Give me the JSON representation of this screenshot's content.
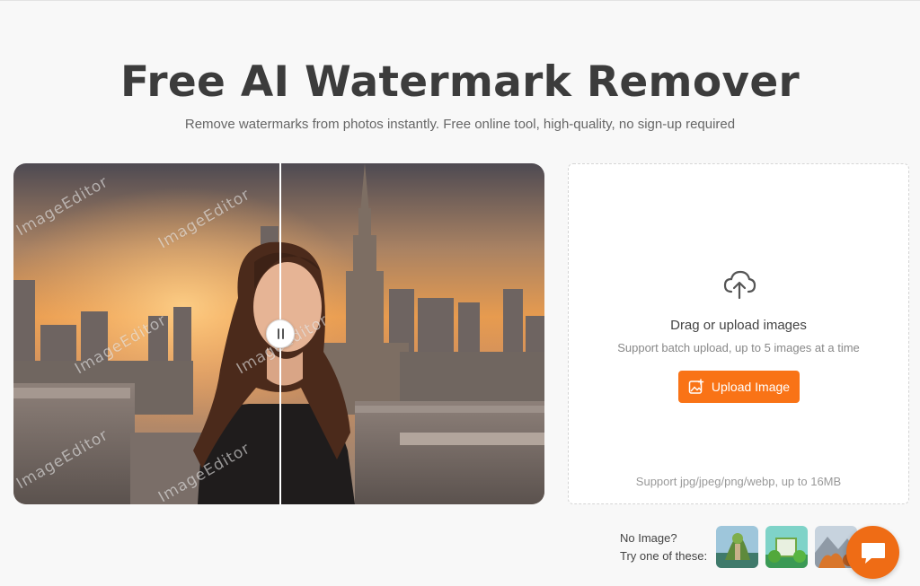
{
  "hero": {
    "title": "Free AI Watermark Remover",
    "subtitle": "Remove watermarks from photos instantly. Free online tool, high-quality, no sign-up required"
  },
  "compare": {
    "watermark_text": "ImageEditor",
    "slider_position": 0.5
  },
  "upload": {
    "icon": "cloud-upload-icon",
    "title": "Drag or upload images",
    "subtitle": "Support batch upload, up to 5 images at a time",
    "button_label": "Upload Image",
    "button_icon": "image-plus-icon",
    "format_note": "Support jpg/jpeg/png/webp, up to 16MB",
    "accent_color": "#f97316"
  },
  "samples": {
    "line1": "No Image?",
    "line2": "Try one of these:",
    "thumbnails": [
      "sample-image-1",
      "sample-image-2",
      "sample-image-3"
    ]
  },
  "chat": {
    "icon": "chat-bubble-icon",
    "color": "#ef6c15"
  }
}
